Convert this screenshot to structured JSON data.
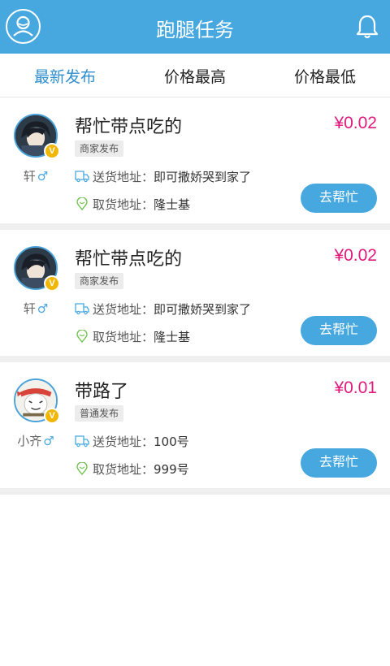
{
  "header": {
    "title": "跑腿任务",
    "left_icon": "profile-icon",
    "right_icon": "bell-icon",
    "bg_color": "#47a8e0"
  },
  "tabs": [
    {
      "label": "最新发布",
      "active": true
    },
    {
      "label": "价格最高",
      "active": false
    },
    {
      "label": "价格最低",
      "active": false
    }
  ],
  "tasks": [
    {
      "user": "轩",
      "gender_symbol": "♂",
      "badge": "V",
      "title": "帮忙带点吃的",
      "price": "¥0.02",
      "tag": "商家发布",
      "delivery_label": "送货地址：",
      "delivery_value": "即可撒娇哭到家了",
      "pickup_label": "取货地址：",
      "pickup_value": "隆士基",
      "action": "去帮忙"
    },
    {
      "user": "轩",
      "gender_symbol": "♂",
      "badge": "V",
      "title": "帮忙带点吃的",
      "price": "¥0.02",
      "tag": "商家发布",
      "delivery_label": "送货地址：",
      "delivery_value": "即可撒娇哭到家了",
      "pickup_label": "取货地址：",
      "pickup_value": "隆士基",
      "action": "去帮忙"
    },
    {
      "user": "小齐",
      "gender_symbol": "♂",
      "badge": "V",
      "title": "带路了",
      "price": "¥0.01",
      "tag": "普通发布",
      "delivery_label": "送货地址：",
      "delivery_value": "100号",
      "pickup_label": "取货地址：",
      "pickup_value": "999号",
      "action": "去帮忙"
    }
  ],
  "colors": {
    "accent": "#47a8e0",
    "price": "#e0197d",
    "tab_active": "#2f8fcf",
    "pickup_icon": "#6cc04a"
  }
}
